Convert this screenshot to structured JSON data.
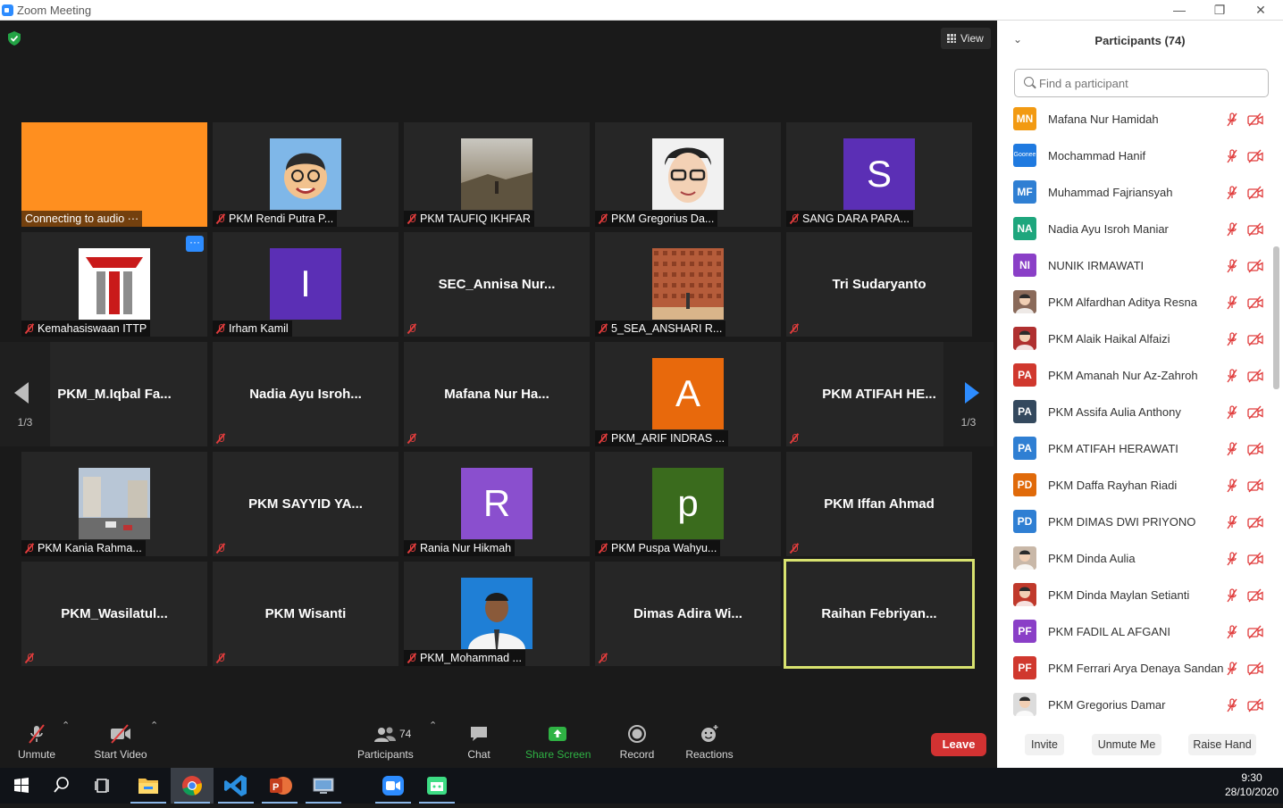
{
  "window": {
    "title": "Zoom Meeting",
    "minimize": "—",
    "restore": "❐",
    "close": "✕"
  },
  "view_button": "View",
  "grid": {
    "tiles": [
      {
        "type": "orange",
        "name": "Connecting to audio ···"
      },
      {
        "type": "avatar-cartoon",
        "name": "PKM Rendi Putra P...",
        "muted": true
      },
      {
        "type": "avatar-photo",
        "name": "PKM TAUFIQ IKHFAR",
        "muted": true
      },
      {
        "type": "avatar-face",
        "name": "PKM Gregorius Da...",
        "muted": true
      },
      {
        "type": "letter",
        "letter": "S",
        "color": "#5b2fb5",
        "name": "SANG DARA PARA...",
        "muted": true
      },
      {
        "type": "logo",
        "name": "Kemahasiswaan ITTP",
        "muted": true,
        "more": "···"
      },
      {
        "type": "letter",
        "letter": "I",
        "color": "#5b2fb5",
        "name": "Irham Kamil",
        "muted": true
      },
      {
        "type": "text",
        "center": "SEC_Annisa  Nur...",
        "muted": true
      },
      {
        "type": "avatar-brick",
        "name": "5_SEA_ANSHARI R...",
        "muted": true
      },
      {
        "type": "text",
        "center": "Tri Sudaryanto",
        "muted": true
      },
      {
        "type": "text",
        "center": "PKM_M.Iqbal  Fa...",
        "muted": true
      },
      {
        "type": "text",
        "center": "Nadia  Ayu  Isroh...",
        "muted": true
      },
      {
        "type": "text",
        "center": "Mafana  Nur  Ha...",
        "muted": true
      },
      {
        "type": "letter",
        "letter": "A",
        "color": "#e8690c",
        "name": "PKM_ARIF INDRAS ...",
        "muted": true
      },
      {
        "type": "text",
        "center": "PKM  ATIFAH  HE...",
        "muted": true
      },
      {
        "type": "avatar-street",
        "name": "PKM Kania Rahma...",
        "muted": true
      },
      {
        "type": "text",
        "center": "PKM  SAYYID  YA...",
        "muted": true
      },
      {
        "type": "letter",
        "letter": "R",
        "color": "#8a4fce",
        "name": "Rania Nur Hikmah",
        "muted": true
      },
      {
        "type": "letter",
        "letter": "p",
        "color": "#3a6b1d",
        "name": "PKM Puspa Wahyu...",
        "muted": true
      },
      {
        "type": "text",
        "center": "PKM  Iffan  Ahmad",
        "muted": true
      },
      {
        "type": "text",
        "center": "PKM_Wasilatul...",
        "muted": true
      },
      {
        "type": "text",
        "center": "PKM  Wisanti",
        "muted": true
      },
      {
        "type": "avatar-student",
        "name": "PKM_Mohammad ...",
        "muted": true
      },
      {
        "type": "text",
        "center": "Dimas  Adira  Wi...",
        "muted": true
      },
      {
        "type": "text",
        "center": "Raihan  Febriyan...",
        "active": true
      }
    ],
    "page_left": "1/3",
    "page_right": "1/3"
  },
  "toolbar": {
    "unmute": "Unmute",
    "start_video": "Start Video",
    "participants": "Participants",
    "participants_count": "74",
    "chat": "Chat",
    "share_screen": "Share Screen",
    "record": "Record",
    "reactions": "Reactions",
    "leave": "Leave",
    "caret": "⌃"
  },
  "panel": {
    "title": "Participants (74)",
    "collapse_icon": "⌄",
    "search_placeholder": "Find a participant",
    "participants": [
      {
        "name": "Mafana Nur Hamidah",
        "initials": "MN",
        "color": "#f29a12"
      },
      {
        "name": "Mochammad Hanif",
        "initials": "Goonee",
        "color": "#1f7ae0"
      },
      {
        "name": "Muhammad Fajriansyah",
        "initials": "MF",
        "color": "#2f7fd3"
      },
      {
        "name": "Nadia Ayu Isroh Maniar",
        "initials": "NA",
        "color": "#1ea67d"
      },
      {
        "name": "NUNIK IRMAWATI",
        "initials": "NI",
        "color": "#8a3fc7"
      },
      {
        "name": "PKM  Alfardhan Aditya Resna",
        "initials": "",
        "color": "#8a6a5a"
      },
      {
        "name": "PKM Alaik Haikal Alfaizi",
        "initials": "",
        "color": "#b03030"
      },
      {
        "name": "PKM Amanah Nur Az-Zahroh",
        "initials": "PA",
        "color": "#d0382e"
      },
      {
        "name": "PKM Assifa Aulia Anthony",
        "initials": "PA",
        "color": "#34495e"
      },
      {
        "name": "PKM ATIFAH HERAWATI",
        "initials": "PA",
        "color": "#2f7fd3"
      },
      {
        "name": "PKM Daffa Rayhan Riadi",
        "initials": "PD",
        "color": "#e06a0a"
      },
      {
        "name": "PKM DIMAS DWI PRIYONO",
        "initials": "PD",
        "color": "#2f7fd3"
      },
      {
        "name": "PKM Dinda Aulia",
        "initials": "",
        "color": "#c9b8a8"
      },
      {
        "name": "PKM Dinda Maylan Setianti",
        "initials": "",
        "color": "#c0392b"
      },
      {
        "name": "PKM FADIL AL AFGANI",
        "initials": "PF",
        "color": "#8a3fc7"
      },
      {
        "name": "PKM Ferrari Arya Denaya Sandan",
        "initials": "PF",
        "color": "#d0382e"
      },
      {
        "name": "PKM Gregorius Damar",
        "initials": "",
        "color": "#dcdcdc"
      }
    ],
    "invite": "Invite",
    "unmute_me": "Unmute Me",
    "raise_hand": "Raise Hand"
  },
  "taskbar": {
    "time": "9:30",
    "date": "28/10/2020",
    "apps": [
      "windows-start",
      "search",
      "task-view",
      "file-explorer",
      "chrome",
      "vscode",
      "powerpoint",
      "remote-desktop",
      "zoom",
      "android-studio"
    ]
  },
  "colors": {
    "accent": "#2d8cff",
    "leave": "#d23232",
    "share": "#2fb344",
    "muted": "#e03c3c",
    "active_speaker": "#d8e26f"
  }
}
